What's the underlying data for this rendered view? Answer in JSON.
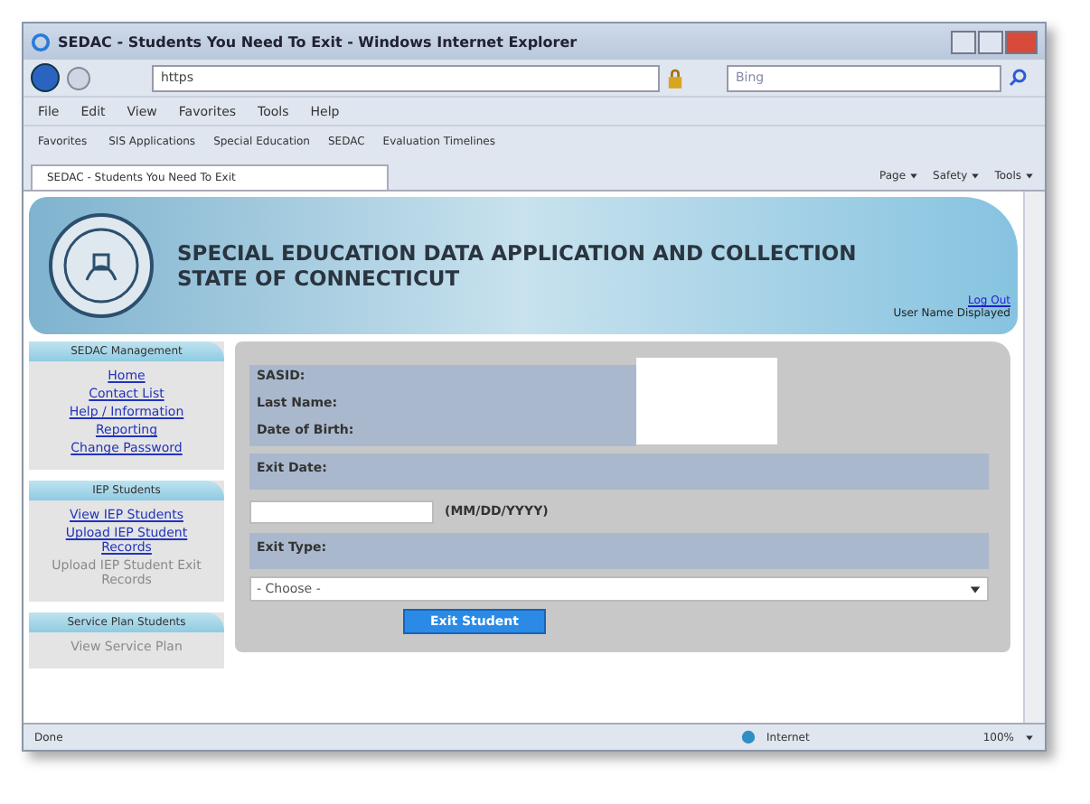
{
  "window": {
    "title": "SEDAC - Students You Need To Exit - Windows Internet Explorer"
  },
  "address_bar": {
    "value": "https"
  },
  "search": {
    "placeholder": "Bing"
  },
  "menu": [
    "File",
    "Edit",
    "View",
    "Favorites",
    "Tools",
    "Help"
  ],
  "favorites_bar": [
    "Favorites",
    "SIS Applications",
    "Special Education",
    "SEDAC",
    "Evaluation Timelines"
  ],
  "tab": {
    "label": "SEDAC - Students You Need To Exit",
    "selected": true
  },
  "command_bar": [
    "Page",
    "Safety",
    "Tools"
  ],
  "header": {
    "title_lines": [
      "SPECIAL EDUCATION DATA APPLICATION AND COLLECTION",
      "STATE OF CONNECTICUT"
    ],
    "logout": "Log Out",
    "user": "User Name Displayed"
  },
  "sidebar": [
    {
      "title": "SEDAC Management",
      "items": [
        {
          "label": "Home",
          "disabled": false
        },
        {
          "label": "Contact List",
          "disabled": false
        },
        {
          "label": "Help / Information",
          "disabled": false
        },
        {
          "label": "Reporting",
          "disabled": false
        },
        {
          "label": "Change Password",
          "disabled": false
        }
      ]
    },
    {
      "title": "IEP Students",
      "items": [
        {
          "label": "View IEP Students",
          "disabled": false
        },
        {
          "label": "Upload IEP Student Records",
          "disabled": false
        },
        {
          "label": "Upload IEP Student Exit Records",
          "disabled": true
        }
      ]
    },
    {
      "title": "Service Plan Students",
      "items": [
        {
          "label": "View Service Plan",
          "disabled": true
        }
      ]
    }
  ],
  "form": {
    "fields": [
      {
        "label": "SASID:"
      },
      {
        "label": "Last Name:"
      },
      {
        "label": "Date of Birth:"
      }
    ],
    "exit_date": {
      "label": "Exit Date:",
      "hint": "(MM/DD/YYYY)"
    },
    "exit_type": {
      "label": "Exit Type:",
      "value": "- Choose -"
    },
    "button": "Exit Student"
  },
  "status_bar": {
    "text": "Done",
    "zone": "Internet",
    "zoom": "100%"
  }
}
